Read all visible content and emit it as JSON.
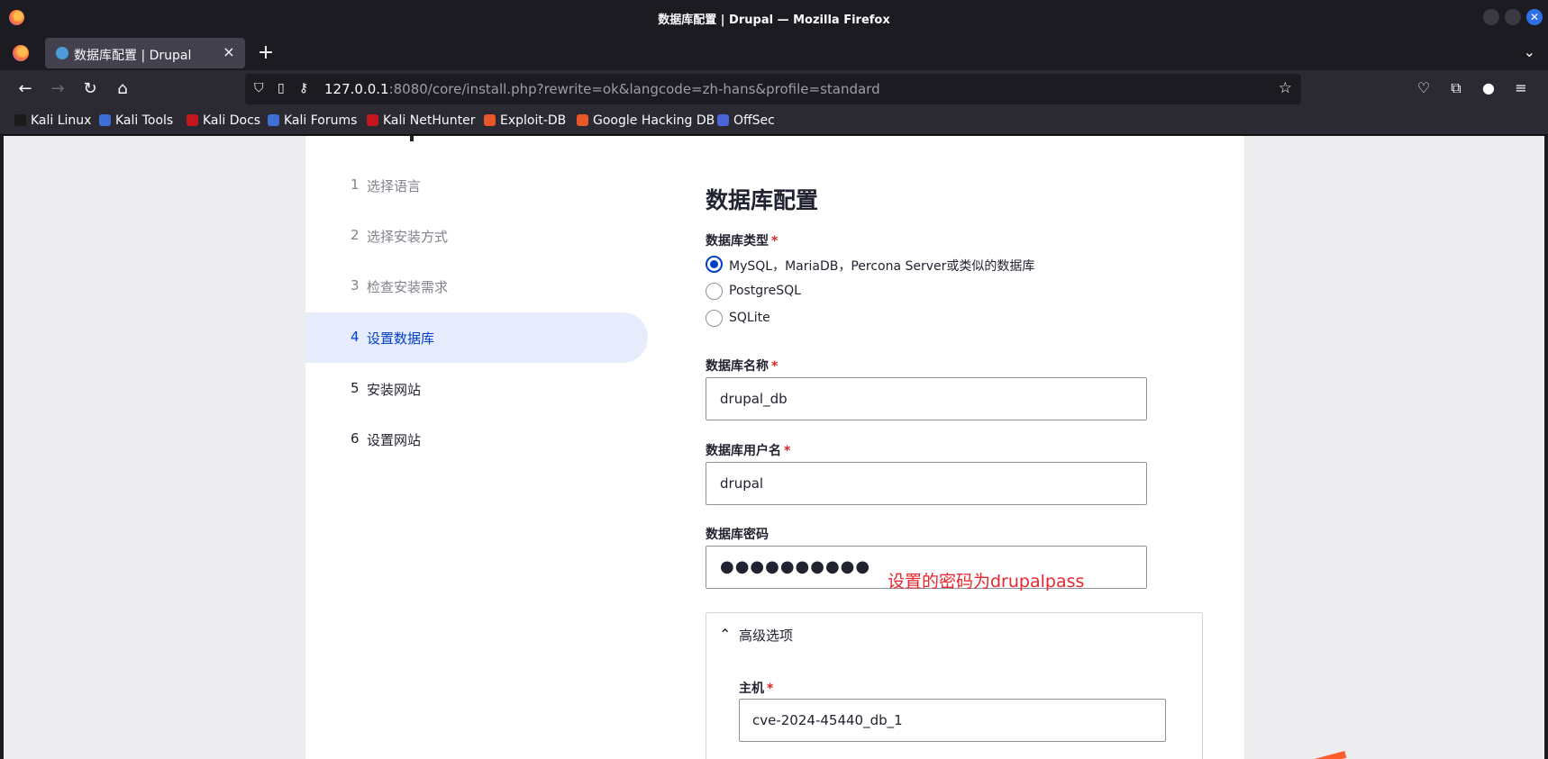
{
  "window": {
    "title": "数据库配置 | Drupal — Mozilla Firefox"
  },
  "tab": {
    "title": "数据库配置 | Drupal",
    "close_glyph": "×",
    "new_tab_glyph": "+",
    "list_all_glyph": "⌄"
  },
  "nav": {
    "back": "←",
    "forward": "→",
    "reload": "↻",
    "home": "⌂",
    "url_host": "127.0.0.1",
    "url_rest": ":8080/core/install.php?rewrite=ok&langcode=zh-hans&profile=standard",
    "star": "☆",
    "menu": "≡"
  },
  "bookmarks": [
    {
      "label": "Kali Linux",
      "color": "#1b1b1b"
    },
    {
      "label": "Kali Tools",
      "color": "#3d6fd6"
    },
    {
      "label": "Kali Docs",
      "color": "#c4161c"
    },
    {
      "label": "Kali Forums",
      "color": "#3d6fd6"
    },
    {
      "label": "Kali NetHunter",
      "color": "#c4161c"
    },
    {
      "label": "Exploit-DB",
      "color": "#e8572a"
    },
    {
      "label": "Google Hacking DB",
      "color": "#e8572a"
    },
    {
      "label": "OffSec",
      "color": "#4a63d8"
    }
  ],
  "steps": [
    {
      "num": "1",
      "label": "选择语言",
      "state": "done"
    },
    {
      "num": "2",
      "label": "选择安装方式",
      "state": "done"
    },
    {
      "num": "3",
      "label": "检查安装需求",
      "state": "done"
    },
    {
      "num": "4",
      "label": "设置数据库",
      "state": "active"
    },
    {
      "num": "5",
      "label": "安装网站",
      "state": "todo"
    },
    {
      "num": "6",
      "label": "设置网站",
      "state": "todo"
    }
  ],
  "form": {
    "title": "数据库配置",
    "db_type_label": "数据库类型",
    "required_mark": "*",
    "db_types": [
      {
        "label": "MySQL，MariaDB，Percona Server或类似的数据库",
        "checked": true
      },
      {
        "label": "PostgreSQL",
        "checked": false
      },
      {
        "label": "SQLite",
        "checked": false
      }
    ],
    "db_name_label": "数据库名称",
    "db_name_value": "drupal_db",
    "db_user_label": "数据库用户名",
    "db_user_value": "drupal",
    "db_pass_label": "数据库密码",
    "db_pass_masked": "●●●●●●●●●●",
    "annotation": "设置的密码为drupalpass",
    "advanced": {
      "chevron": "^",
      "title": "高级选项",
      "host_label": "主机",
      "host_value": "cve-2024-45440_db_1"
    }
  },
  "colors": {
    "accent": "#003ecc",
    "active_step_bg": "#e6ecfc",
    "required": "#dc2323",
    "annotation": "#e8262e"
  }
}
